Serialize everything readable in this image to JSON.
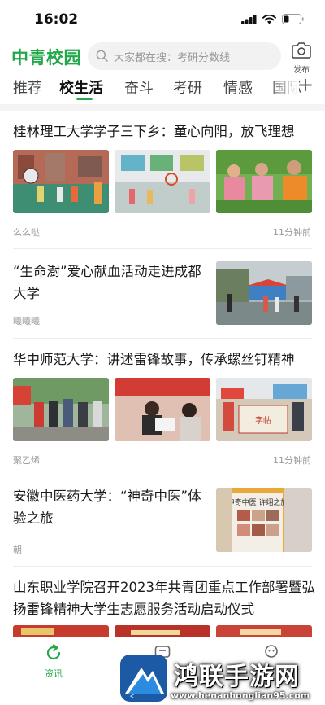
{
  "status_bar": {
    "time": "16:02"
  },
  "header": {
    "logo_text": "中青校园",
    "search_placeholder": "大家都在搜：考研分数线",
    "publish_label": "发布"
  },
  "tabs": [
    {
      "label": "推荐"
    },
    {
      "label": "校生活",
      "active": true
    },
    {
      "label": "奋斗"
    },
    {
      "label": "考研"
    },
    {
      "label": "情感"
    },
    {
      "label": "国际"
    }
  ],
  "feed": [
    {
      "title": "桂林理工大学学子三下乡：童心向阳，放飞理想",
      "author": "么么哒",
      "time": "11分钟前",
      "layout": "three-images"
    },
    {
      "title": "“生命澍”爱心献血活动走进成都大学",
      "author": "曦曦曦",
      "layout": "right-image"
    },
    {
      "title": "华中师范大学：讲述雷锋故事，传承螺丝钉精神",
      "author": "聚乙烯",
      "time": "11分钟前",
      "layout": "three-images"
    },
    {
      "title": "安徽中医药大学：“神奇中医”体验之旅",
      "author": "朝",
      "layout": "right-image",
      "image_caption": "神奇中医 许翊之旅"
    },
    {
      "title": "山东职业学院召开2023年共青团重点工作部署暨弘扬雷锋精神大学生志愿服务活动启动仪式",
      "layout": "three-images"
    }
  ],
  "bottom_nav": {
    "items": [
      {
        "label": "资讯",
        "icon": "refresh-icon",
        "active": true
      },
      {
        "label": "",
        "icon": "message-icon"
      },
      {
        "label": "",
        "icon": "profile-icon"
      }
    ]
  },
  "watermark": {
    "text": "鸿联手游网",
    "url": "www.henanhonglian95.com"
  },
  "colors": {
    "brand_green": "#22a84a"
  }
}
